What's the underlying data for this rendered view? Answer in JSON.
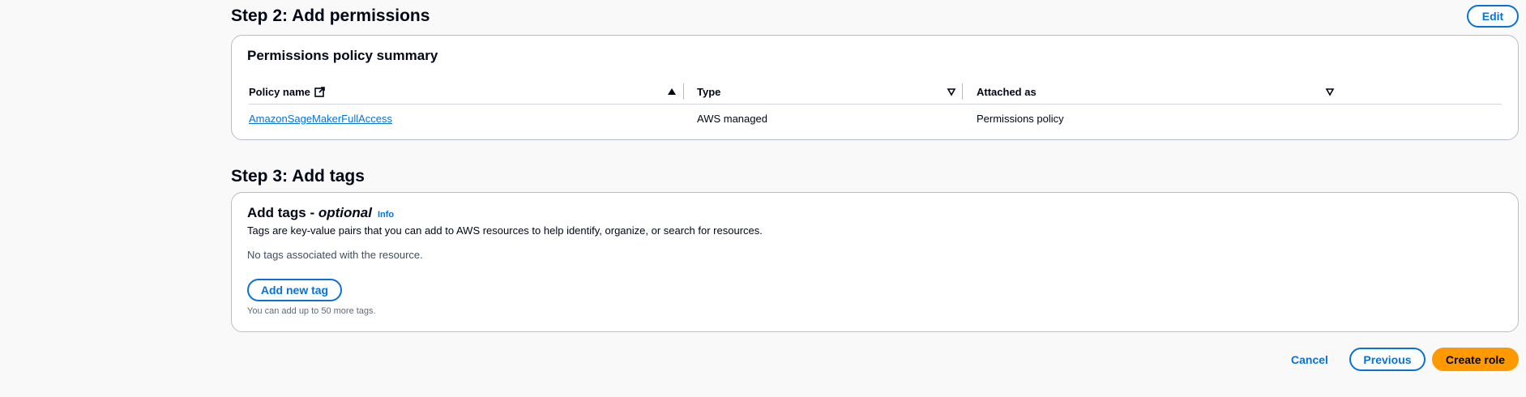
{
  "step2": {
    "title": "Step 2: Add permissions",
    "edit_label": "Edit",
    "container_title": "Permissions policy summary",
    "columns": [
      "Policy name",
      "Type",
      "Attached as"
    ],
    "sort": {
      "policy_name": "ascending",
      "type": "none",
      "attached_as": "none"
    },
    "rows": [
      {
        "policy_name": "AmazonSageMakerFullAccess",
        "type": "AWS managed",
        "attached_as": "Permissions policy"
      }
    ]
  },
  "step3": {
    "title": "Step 3: Add tags",
    "container_title": "Add tags - ",
    "optional": "optional",
    "info": "Info",
    "description": "Tags are key-value pairs that you can add to AWS resources to help identify, organize, or search for resources.",
    "no_tags": "No tags associated with the resource.",
    "add_tag_label": "Add new tag",
    "hint": "You can add up to 50 more tags."
  },
  "footer": {
    "cancel_label": "Cancel",
    "previous_label": "Previous",
    "create_label": "Create role"
  },
  "colors": {
    "link": "#0972d3",
    "primary": "#ff9900",
    "border": "#b6bec9"
  }
}
